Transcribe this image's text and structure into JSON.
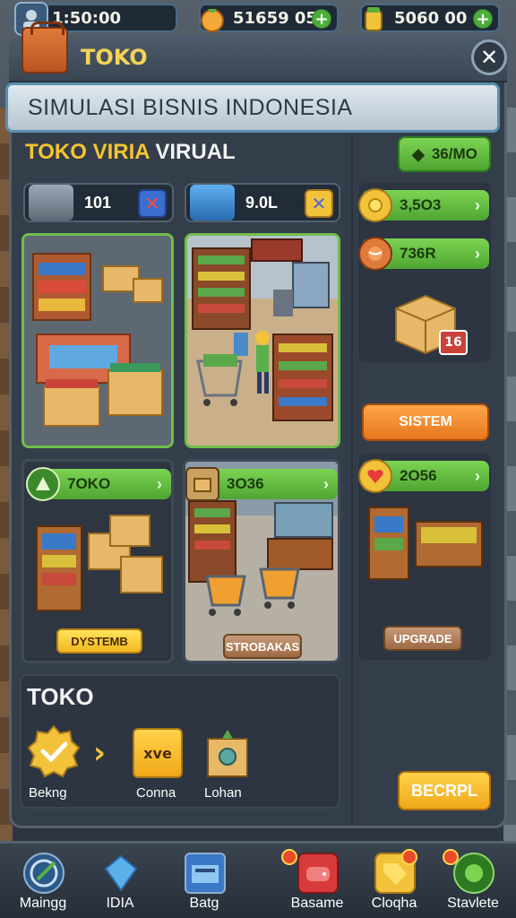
{
  "topbar": {
    "timer": "1:50:00",
    "coins": "51659 05",
    "gems": "5060 00"
  },
  "header": {
    "title": "TOKO",
    "close_symbol": "✕"
  },
  "banner": {
    "text": "SIMULASI BISNIS INDONESIA"
  },
  "section": {
    "title_part1": "TOKO VIRIA",
    "title_part2": "VIRUAL"
  },
  "counters": [
    {
      "value": "101",
      "x_symbol": "✕"
    },
    {
      "value": "9.0L",
      "x_symbol": "✕"
    }
  ],
  "cards": {
    "card3_pill": "7OKO",
    "card3_button": "DYSTEMB",
    "card4_pill": "3O36",
    "card4_button": "STROBAKAS"
  },
  "right": {
    "top_pill": "36/MO",
    "pill1": "3,5O3",
    "pill2": "736R",
    "box_badge": "16",
    "orange_button": "SISTEM",
    "pill3": "2O56",
    "brown_button": "UPGRADE"
  },
  "toko_box": {
    "title": "TOKO",
    "items": [
      "Bekng",
      "Conna",
      "Lohan"
    ],
    "arrow": "›",
    "gold_label": "xve",
    "gold_button": "BECRPL"
  },
  "nav": [
    {
      "label": "Maingg"
    },
    {
      "label": "IDIA"
    },
    {
      "label": "Batg"
    },
    {
      "label": "Basame"
    },
    {
      "label": "Cloqha"
    },
    {
      "label": "Stavlete"
    }
  ],
  "colors": {
    "accent_green": "#6fbf4a",
    "accent_yellow": "#f5c531",
    "panel_bg": "#343d4a"
  }
}
